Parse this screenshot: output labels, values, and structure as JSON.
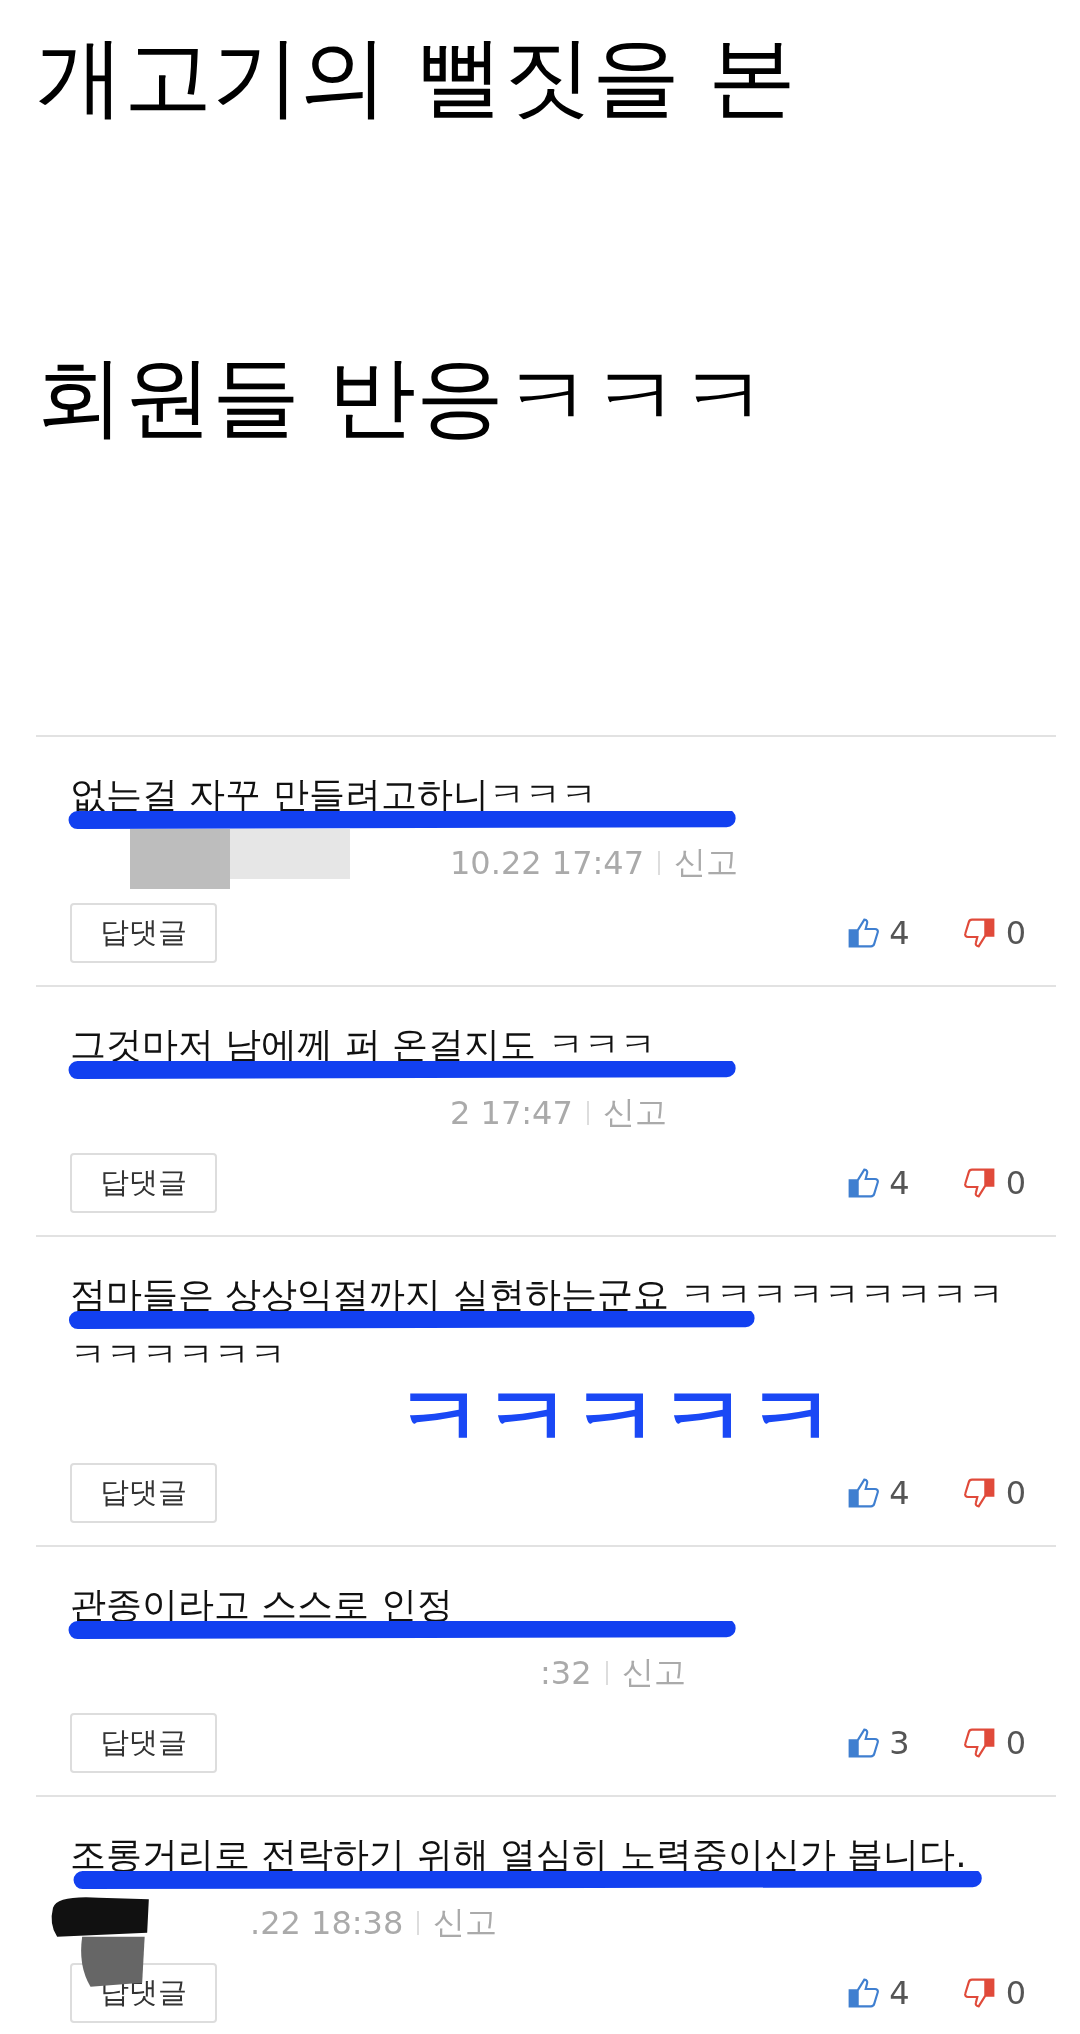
{
  "title_lines": [
    "개고기의 뻘짓을 본",
    "회원들 반응ㅋㅋㅋ"
  ],
  "comments": [
    {
      "text": "없는걸 자꾸 만들려고하니ㅋㅋㅋ",
      "underlined": true,
      "meta": "10.22  17:47",
      "report": "신고",
      "redacted": true,
      "reply": "답댓글",
      "likes": "4",
      "dislikes": "0"
    },
    {
      "text": "그것마저 남에께 퍼 온걸지도 ㅋㅋㅋ",
      "underlined": true,
      "meta": "2  17:47",
      "report": "신고",
      "reply": "답댓글",
      "likes": "4",
      "dislikes": "0"
    },
    {
      "text": "점마들은 상상익절까지 실현하는군요 ㅋㅋㅋㅋㅋㅋㅋㅋㅋㅋㅋㅋㅋㅋㅋ",
      "underlined": true,
      "scrawl": "ㅋㅋㅋㅋㅋ",
      "reply": "답댓글",
      "likes": "4",
      "dislikes": "0"
    },
    {
      "text": "관종이라고 스스로 인정",
      "underlined": true,
      "meta": ":32",
      "report": "신고",
      "reply": "답댓글",
      "likes": "3",
      "dislikes": "0"
    },
    {
      "text": "조롱거리로 전락하기 위해 열심히 노력중이신가 봅니다.",
      "underlined": true,
      "meta": ".22  18:38",
      "report": "신고",
      "redacted": true,
      "reply": "답댓글",
      "likes": "4",
      "dislikes": "0"
    }
  ]
}
